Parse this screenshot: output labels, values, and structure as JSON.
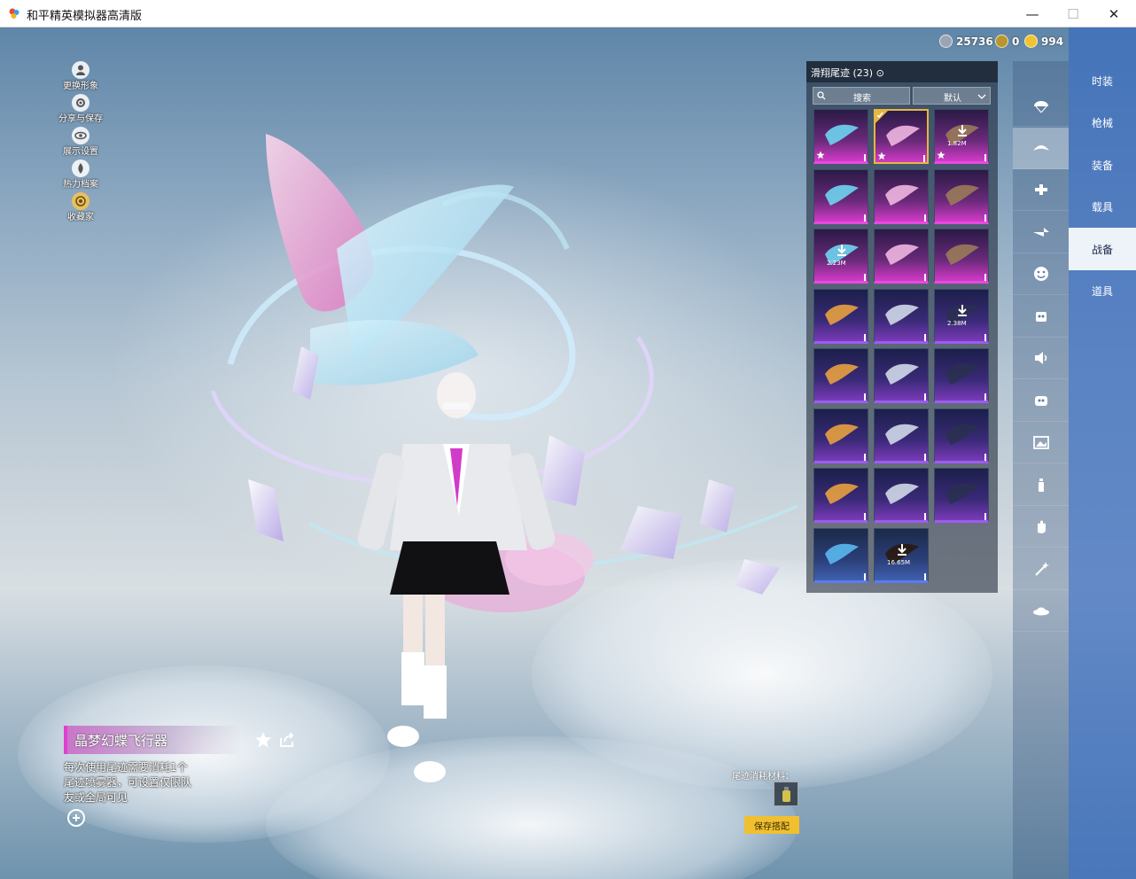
{
  "window": {
    "title": "和平精英模拟器高清版",
    "minimize": "—",
    "maximize": "☐",
    "close": "✕"
  },
  "currency": [
    {
      "icon": "silver-coin-icon",
      "value": "25736"
    },
    {
      "icon": "badge-coin-icon",
      "value": "0"
    },
    {
      "icon": "gold-coin-icon",
      "value": "994"
    }
  ],
  "side_menu": [
    {
      "label": "更换形象",
      "icon": "person-icon"
    },
    {
      "label": "分享与保存",
      "icon": "share-gear-icon"
    },
    {
      "label": "展示设置",
      "icon": "eye-icon"
    },
    {
      "label": "热力档案",
      "icon": "flame-icon"
    },
    {
      "label": "收藏家",
      "icon": "collector-badge-icon"
    }
  ],
  "item": {
    "name": "晶梦幻蝶飞行器",
    "description": "每次使用尾迹需要消耗1个尾迹喷雾器，可设置仅限队友或全局可见"
  },
  "list": {
    "title": "滑翔尾迹 (23) ⊙",
    "search_placeholder": "搜索",
    "sort_label": "默认"
  },
  "grid_items": [
    {
      "rarity": "pink",
      "name": "glider-teal-wing",
      "star": true,
      "selected": false,
      "size": ""
    },
    {
      "rarity": "pink",
      "name": "glider-butterfly-crystal",
      "star": true,
      "selected": true,
      "size": ""
    },
    {
      "rarity": "pink",
      "name": "glider-download-1",
      "star": true,
      "selected": false,
      "size": "1.82M"
    },
    {
      "rarity": "pink",
      "name": "glider-pink-crystal",
      "star": false,
      "selected": false,
      "size": ""
    },
    {
      "rarity": "pink",
      "name": "glider-purple-blade",
      "star": false,
      "selected": false,
      "size": ""
    },
    {
      "rarity": "pink",
      "name": "glider-teal-jet",
      "star": false,
      "selected": false,
      "size": ""
    },
    {
      "rarity": "pink",
      "name": "glider-download-2",
      "star": false,
      "selected": false,
      "size": "2.23M"
    },
    {
      "rarity": "pink",
      "name": "glider-blue-wing",
      "star": false,
      "selected": false,
      "size": ""
    },
    {
      "rarity": "pink",
      "name": "glider-comet",
      "star": false,
      "selected": false,
      "size": ""
    },
    {
      "rarity": "purple",
      "name": "glider-pony",
      "star": false,
      "selected": false,
      "size": ""
    },
    {
      "rarity": "purple",
      "name": "glider-white-craft",
      "star": false,
      "selected": false,
      "size": ""
    },
    {
      "rarity": "purple",
      "name": "glider-download-3",
      "star": false,
      "selected": false,
      "size": "2.38M"
    },
    {
      "rarity": "purple",
      "name": "glider-chick",
      "star": false,
      "selected": false,
      "size": ""
    },
    {
      "rarity": "purple",
      "name": "trail-rainbow",
      "star": false,
      "selected": false,
      "size": ""
    },
    {
      "rarity": "purple",
      "name": "glider-ufo",
      "star": false,
      "selected": false,
      "size": ""
    },
    {
      "rarity": "purple",
      "name": "glider-shark",
      "star": false,
      "selected": false,
      "size": ""
    },
    {
      "rarity": "purple",
      "name": "glider-mech-wing",
      "star": false,
      "selected": false,
      "size": ""
    },
    {
      "rarity": "purple",
      "name": "trail-blue",
      "star": false,
      "selected": false,
      "size": ""
    },
    {
      "rarity": "purple",
      "name": "trail-yellow",
      "star": false,
      "selected": false,
      "size": ""
    },
    {
      "rarity": "purple",
      "name": "trail-red",
      "star": false,
      "selected": false,
      "size": ""
    },
    {
      "rarity": "purple",
      "name": "trail-orange-purple",
      "star": false,
      "selected": false,
      "size": ""
    },
    {
      "rarity": "blue",
      "name": "glider-paper-plane",
      "star": false,
      "selected": false,
      "size": ""
    },
    {
      "rarity": "blue",
      "name": "glider-download-4",
      "star": false,
      "selected": false,
      "size": "16.65M"
    }
  ],
  "categories": [
    {
      "icon": "parachute-icon",
      "active": false
    },
    {
      "icon": "glider-icon",
      "active": true
    },
    {
      "icon": "aircraft-icon",
      "active": false
    },
    {
      "icon": "plane-icon",
      "active": false
    },
    {
      "icon": "emote-face-icon",
      "active": false
    },
    {
      "icon": "robot-icon",
      "active": false
    },
    {
      "icon": "speaker-icon",
      "active": false
    },
    {
      "icon": "pet-icon",
      "active": false
    },
    {
      "icon": "photo-frame-icon",
      "active": false
    },
    {
      "icon": "spray-can-icon",
      "active": false
    },
    {
      "icon": "hand-wave-icon",
      "active": false
    },
    {
      "icon": "sparkle-wand-icon",
      "active": false
    },
    {
      "icon": "ufo-icon",
      "active": false
    }
  ],
  "tabs": [
    {
      "label": "时装",
      "active": false
    },
    {
      "label": "枪械",
      "active": false
    },
    {
      "label": "装备",
      "active": false
    },
    {
      "label": "载具",
      "active": false
    },
    {
      "label": "战备",
      "active": true
    },
    {
      "label": "道具",
      "active": false
    }
  ],
  "material": {
    "label": "尾迹消耗材料：",
    "save_label": "保存搭配"
  }
}
